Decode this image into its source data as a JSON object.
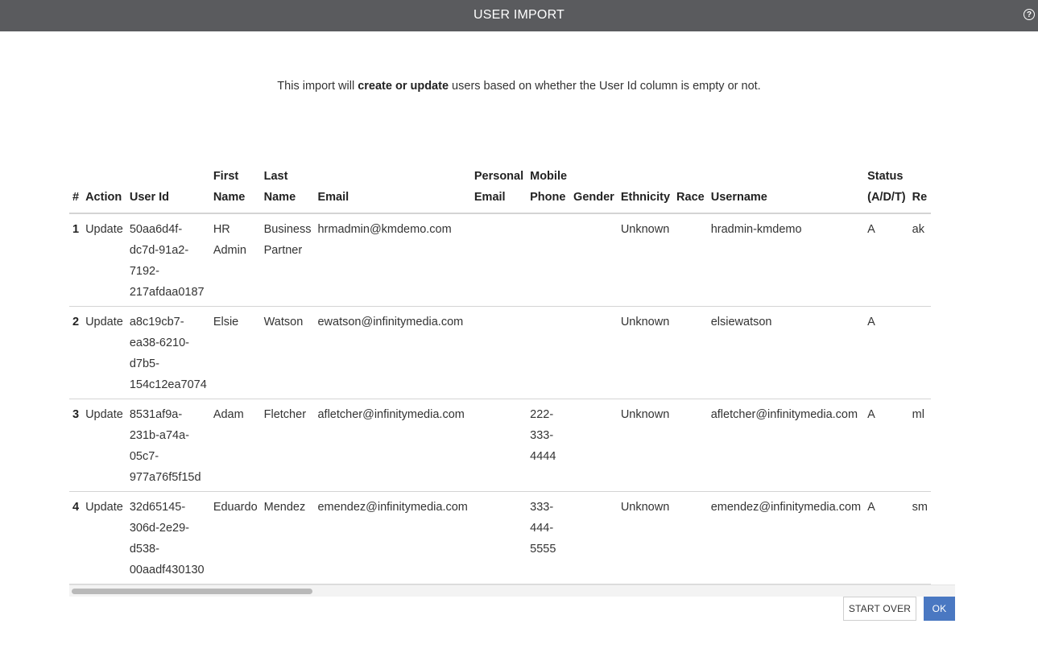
{
  "dialog": {
    "title": "USER IMPORT",
    "help_icon": "question-circle-icon",
    "help_glyph": "?"
  },
  "intro": {
    "before": "This import will ",
    "bold": "create or update",
    "after": " users based on whether the User Id column is empty or not."
  },
  "table": {
    "headers": [
      {
        "key": "num",
        "line1": "",
        "line2": "#"
      },
      {
        "key": "action",
        "line1": "",
        "line2": "Action"
      },
      {
        "key": "user_id",
        "line1": "",
        "line2": "User Id"
      },
      {
        "key": "first_name",
        "line1": "First",
        "line2": "Name"
      },
      {
        "key": "last_name",
        "line1": "Last",
        "line2": "Name"
      },
      {
        "key": "email",
        "line1": "",
        "line2": "Email"
      },
      {
        "key": "personal_email",
        "line1": "Personal",
        "line2": "Email"
      },
      {
        "key": "mobile_phone",
        "line1": "Mobile",
        "line2": "Phone"
      },
      {
        "key": "gender",
        "line1": "",
        "line2": "Gender"
      },
      {
        "key": "ethnicity",
        "line1": "",
        "line2": "Ethnicity"
      },
      {
        "key": "race",
        "line1": "",
        "line2": "Race"
      },
      {
        "key": "username",
        "line1": "",
        "line2": "Username"
      },
      {
        "key": "status",
        "line1": "Status",
        "line2": "(A/D/T)"
      },
      {
        "key": "re",
        "line1": "",
        "line2": "Re"
      }
    ],
    "rows": [
      {
        "num": "1",
        "action": "Update",
        "user_id": [
          "50aa6d4f-",
          "dc7d-91a2-",
          "7192-",
          "217afdaa0187"
        ],
        "first_name": [
          "HR",
          "Admin"
        ],
        "last_name": [
          "Business",
          "Partner"
        ],
        "email": [
          "hrmadmin@kmdemo.com"
        ],
        "personal_email": [],
        "mobile_phone": [],
        "gender": [],
        "ethnicity": [
          "Unknown"
        ],
        "race": [],
        "username": [
          "hradmin-kmdemo"
        ],
        "status": [
          "A"
        ],
        "re": [
          "ak"
        ]
      },
      {
        "num": "2",
        "action": "Update",
        "user_id": [
          "a8c19cb7-",
          "ea38-6210-",
          "d7b5-",
          "154c12ea7074"
        ],
        "first_name": [
          "Elsie"
        ],
        "last_name": [
          "Watson"
        ],
        "email": [
          "ewatson@infinitymedia.com"
        ],
        "personal_email": [],
        "mobile_phone": [],
        "gender": [],
        "ethnicity": [
          "Unknown"
        ],
        "race": [],
        "username": [
          "elsiewatson"
        ],
        "status": [
          "A"
        ],
        "re": []
      },
      {
        "num": "3",
        "action": "Update",
        "user_id": [
          "8531af9a-",
          "231b-a74a-",
          "05c7-",
          "977a76f5f15d"
        ],
        "first_name": [
          "Adam"
        ],
        "last_name": [
          "Fletcher"
        ],
        "email": [
          "afletcher@infinitymedia.com"
        ],
        "personal_email": [],
        "mobile_phone": [
          "222-",
          "333-",
          "4444"
        ],
        "gender": [],
        "ethnicity": [
          "Unknown"
        ],
        "race": [],
        "username": [
          "afletcher@infinitymedia.com"
        ],
        "status": [
          "A"
        ],
        "re": [
          "ml"
        ]
      },
      {
        "num": "4",
        "action": "Update",
        "user_id": [
          "32d65145-",
          "306d-2e29-",
          "d538-",
          "00aadf430130"
        ],
        "first_name": [
          "Eduardo"
        ],
        "last_name": [
          "Mendez"
        ],
        "email": [
          "emendez@infinitymedia.com"
        ],
        "personal_email": [],
        "mobile_phone": [
          "333-",
          "444-",
          "5555"
        ],
        "gender": [],
        "ethnicity": [
          "Unknown"
        ],
        "race": [],
        "username": [
          "emendez@infinitymedia.com"
        ],
        "status": [
          "A"
        ],
        "re": [
          "sm"
        ]
      }
    ]
  },
  "buttons": {
    "start_over": "START OVER",
    "ok": "OK"
  },
  "colors": {
    "titlebar": "#5a5b5e",
    "primary": "#4a78c2",
    "row_border": "#d4d4d4"
  }
}
